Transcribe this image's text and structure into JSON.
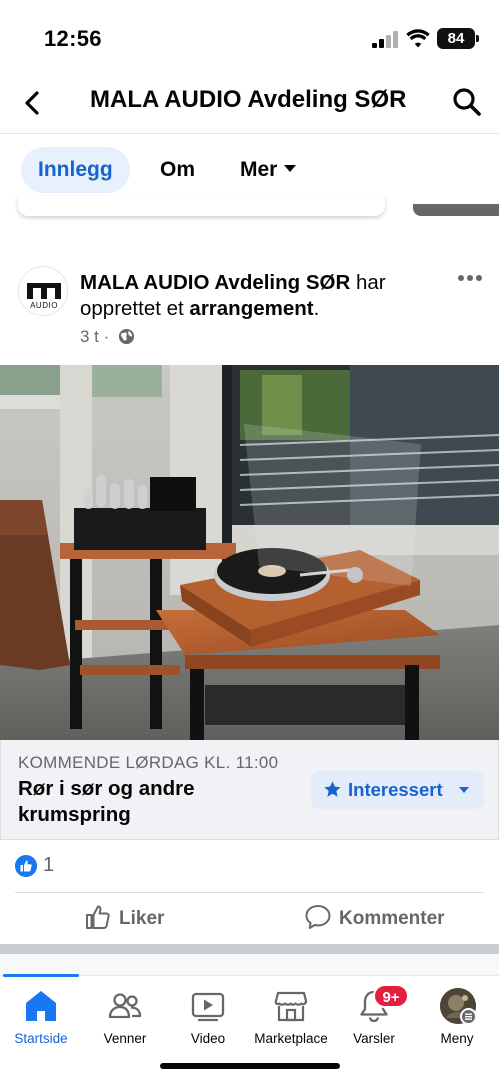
{
  "status_bar": {
    "time": "12:56",
    "battery": "84"
  },
  "header": {
    "title": "MALA AUDIO Avdeling SØR"
  },
  "tabs": [
    {
      "label": "Innlegg",
      "active": true
    },
    {
      "label": "Om",
      "active": false
    },
    {
      "label": "Mer",
      "active": false
    }
  ],
  "post": {
    "avatar_text": "AUDIO",
    "author": "MALA AUDIO Avdeling SØR",
    "action_text": " har opprettet et ",
    "object": "arrangement",
    "suffix": ".",
    "time": "3 t",
    "separator": "·"
  },
  "event": {
    "date": "KOMMENDE LØRDAG KL. 11:00",
    "title": "Rør i sør og andre krumspring",
    "interest_label": "Interessert"
  },
  "reactions": {
    "count": "1"
  },
  "actions": {
    "like": "Liker",
    "comment": "Kommenter"
  },
  "nav": {
    "items": [
      {
        "label": "Startside",
        "icon": "home-icon",
        "active": true
      },
      {
        "label": "Venner",
        "icon": "friends-icon",
        "active": false
      },
      {
        "label": "Video",
        "icon": "video-icon",
        "active": false
      },
      {
        "label": "Marketplace",
        "icon": "marketplace-icon",
        "active": false
      },
      {
        "label": "Varsler",
        "icon": "bell-icon",
        "active": false
      },
      {
        "label": "Meny",
        "icon": "profile-menu-icon",
        "active": false
      }
    ],
    "notification_badge": "9+"
  },
  "colors": {
    "accent": "#1877f2",
    "accent_text": "#1763cf",
    "badge": "#e41e3f",
    "secondary_text": "#65676b"
  }
}
